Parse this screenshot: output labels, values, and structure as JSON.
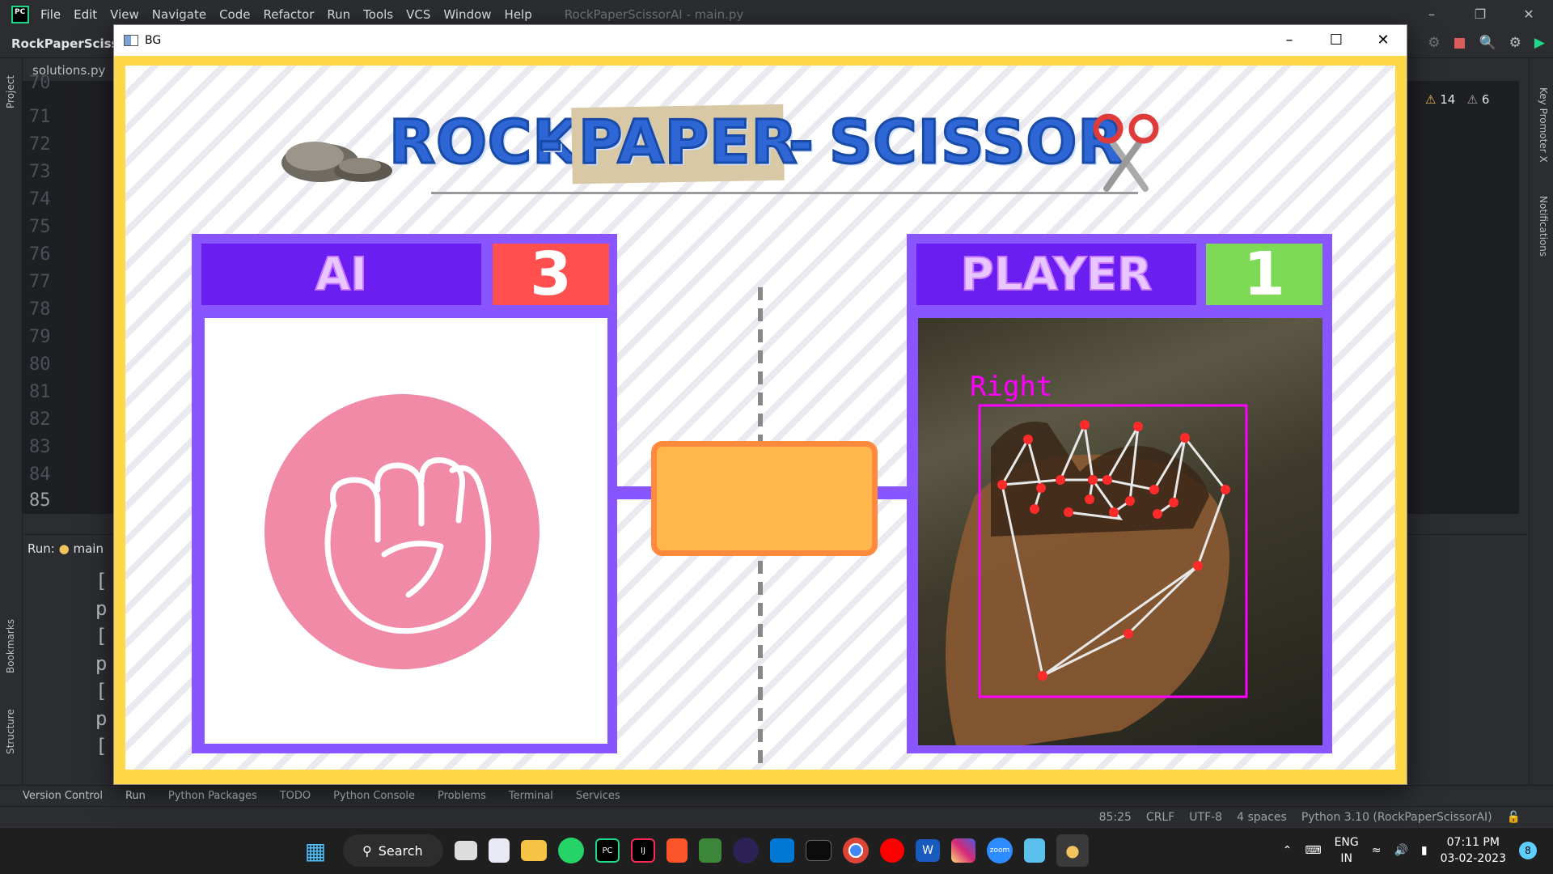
{
  "ide": {
    "menu": [
      "File",
      "Edit",
      "View",
      "Navigate",
      "Code",
      "Refactor",
      "Run",
      "Tools",
      "VCS",
      "Window",
      "Help"
    ],
    "title": "RockPaperScissorAI - main.py",
    "project_name": "RockPaperScissor",
    "editor_tab": "solutions.py",
    "line_numbers": [
      "70",
      "71",
      "72",
      "73",
      "74",
      "75",
      "76",
      "77",
      "78",
      "79",
      "80",
      "81",
      "82",
      "83",
      "84",
      "85"
    ],
    "current_line": "85",
    "run_label": "Run:",
    "run_tab": "main",
    "console_lines": [
      "[",
      "p",
      "[",
      "p",
      "[",
      "p",
      "["
    ],
    "warnings": "14",
    "weak_warnings": "6",
    "left_labels": [
      "Project",
      "Bookmarks",
      "Structure"
    ],
    "right_labels": [
      "Key Promoter X",
      "Notifications"
    ],
    "bottom_tools": [
      "Version Control",
      "Run",
      "Python Packages",
      "TODO",
      "Python Console",
      "Problems",
      "Terminal",
      "Services"
    ],
    "status": [
      "85:25",
      "CRLF",
      "UTF-8",
      "4 spaces",
      "Python 3.10 (RockPaperScissorAI)"
    ]
  },
  "game_window": {
    "title": "BG",
    "heading": {
      "rock": "ROCK",
      "dash1": "-",
      "paper": "PAPER",
      "dash2": "-",
      "scissor": "SCISSOR"
    },
    "ai": {
      "label": "AI",
      "score": "3",
      "move_icon": "fist-icon"
    },
    "player": {
      "label": "PLAYER",
      "score": "1",
      "hand_label": "Right"
    },
    "colors": {
      "frame": "#ffd84a",
      "panel": "#8855ff",
      "panel_head": "#6a1ff0",
      "ai_score_bg": "#ff4f4f",
      "player_score_bg": "#7ed957",
      "center_box": "#ffb74d",
      "hand_box": "#ff00ff",
      "landmark": "#ff2a2a"
    }
  },
  "taskbar": {
    "search": "Search",
    "lang_top": "ENG",
    "lang_bottom": "IN",
    "time": "07:11 PM",
    "date": "03-02-2023",
    "notifications": "8"
  }
}
